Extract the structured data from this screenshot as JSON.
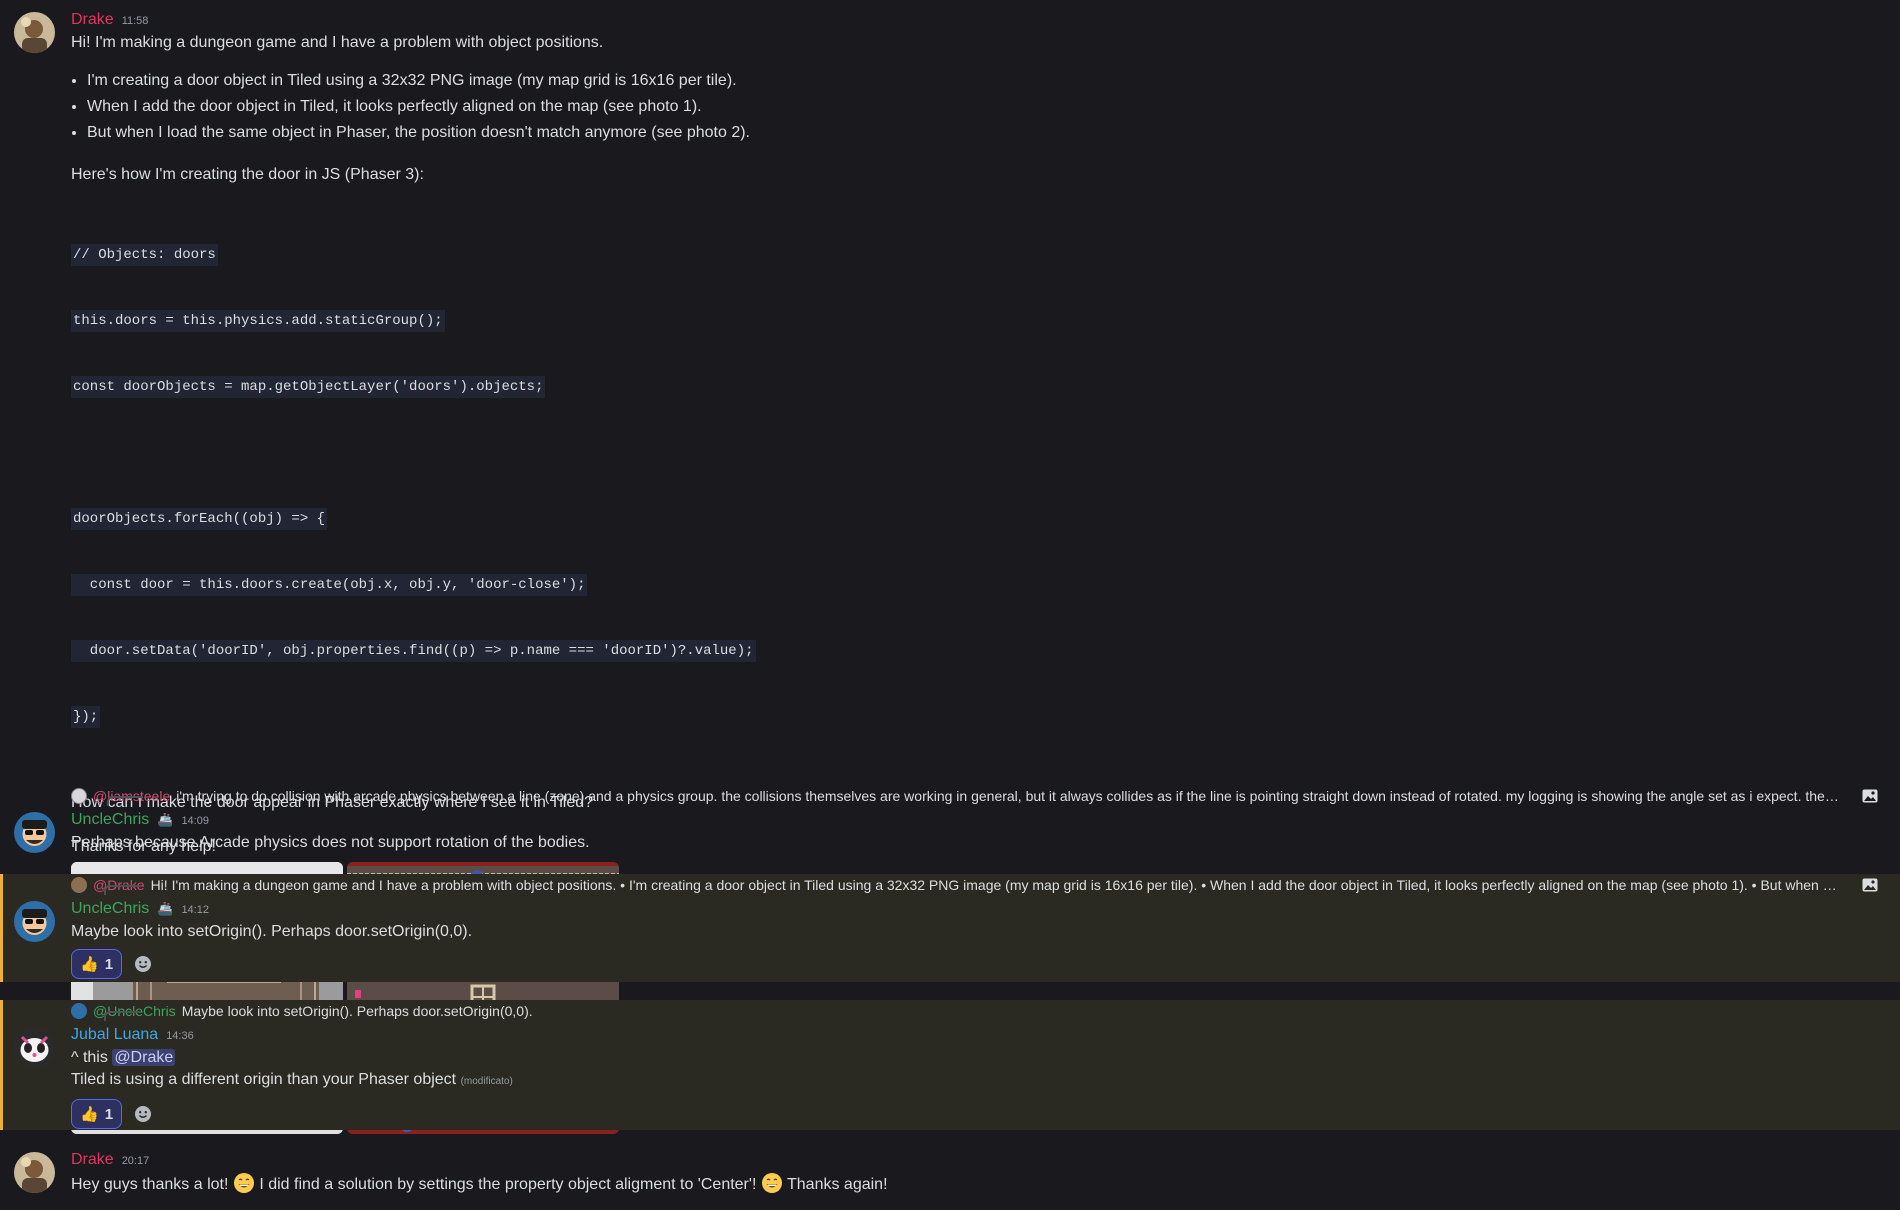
{
  "messages": {
    "m1": {
      "username": "Drake",
      "time": "11:58",
      "line1": "Hi! I'm making a dungeon game and I have a problem with object positions.",
      "bullets": [
        "I'm creating a door object in Tiled using a 32x32 PNG image (my map grid is 16x16 per tile).",
        "When I add the door object in Tiled, it looks perfectly aligned on the map (see photo 1).",
        "But when I load the same object in Phaser, the position doesn't match anymore (see photo 2)."
      ],
      "intro_code": "Here's how I'm creating the door in JS (Phaser 3):",
      "code": [
        "// Objects: doors",
        "this.doors = this.physics.add.staticGroup();",
        "const doorObjects = map.getObjectLayer('doors').objects;",
        "",
        "doorObjects.forEach((obj) => {",
        "  const door = this.doors.create(obj.x, obj.y, 'door-close');",
        "  door.setData('doorID', obj.properties.find((p) => p.name === 'doorID')?.value);",
        "});"
      ],
      "question": "How can I make the door appear in Phaser exactly where I see it in Tiled?",
      "thanks": "Thanks for any help!"
    },
    "m2": {
      "reply_name": "@liamsteele",
      "reply_text": "i'm trying to do collision with arcade physics between a line (zone) and a physics group. the collisions themselves are working in general, but it always collides as if the line is pointing straight down instead of rotated. my logging is showing the angle set as i expect. the docs mention ar...",
      "username": "UncleChris",
      "time": "14:09",
      "text": "Perhaps because Arcade physics does not support rotation of the bodies."
    },
    "m3": {
      "reply_name": "@Drake",
      "reply_text": "Hi! I'm making a dungeon game and I have a problem with object positions.  • I'm creating a door object in Tiled using a 32x32 PNG image (my map grid is 16x16 per tile).  • When I add the door object in Tiled, it looks perfectly aligned on the map (see photo 1).  • But when I load the same obj...",
      "username": "UncleChris",
      "time": "14:12",
      "text": "Maybe look into setOrigin().  Perhaps door.setOrigin(0,0).",
      "reaction_count": "1"
    },
    "m4": {
      "reply_name": "@UncleChris",
      "reply_text": "Maybe look into setOrigin().  Perhaps door.setOrigin(0,0).",
      "username": "Jubal Luana",
      "time": "14:36",
      "line1_pre": "^ this",
      "line1_mention": "@Drake",
      "line2": "Tiled is using a different origin than your Phaser object",
      "edited": "(modificato)",
      "reaction_count": "1"
    },
    "m5": {
      "username": "Drake",
      "time": "20:17",
      "part1": "Hey guys thanks a lot!",
      "part2": "I did find a solution by settings the property object aligment to 'Center'!",
      "part3": "Thanks again!"
    }
  },
  "colors": {
    "drake": "#e0345f",
    "unclechris": "#3ba55d",
    "jubal": "#3aa8e4",
    "mention_bar": "#f0b132"
  },
  "icons": [
    "image-icon",
    "thumbs-up-emoji",
    "add-reaction-icon",
    "grin-emoji"
  ]
}
